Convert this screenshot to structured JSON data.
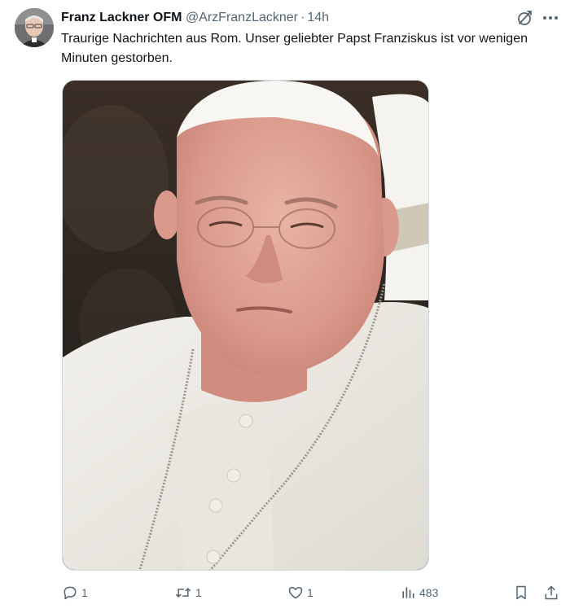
{
  "author": {
    "display_name": "Franz Lackner OFM",
    "handle": "@ArzFranzLackner",
    "separator": "·",
    "time": "14h"
  },
  "tweet": {
    "text": "Traurige Nachrichten aus Rom. Unser geliebter Papst Franziskus ist vor wenigen Minuten gestorben."
  },
  "actions": {
    "reply_count": "1",
    "retweet_count": "1",
    "like_count": "1",
    "view_count": "483"
  },
  "icons": {
    "reply": "reply-icon",
    "retweet": "retweet-icon",
    "like": "heart-icon",
    "views": "analytics-icon",
    "bookmark": "bookmark-icon",
    "share": "share-icon",
    "grok": "grok-icon",
    "more": "more-icon"
  },
  "colors": {
    "text_primary": "#0f1419",
    "text_secondary": "#536471",
    "border": "#cfd9de"
  }
}
